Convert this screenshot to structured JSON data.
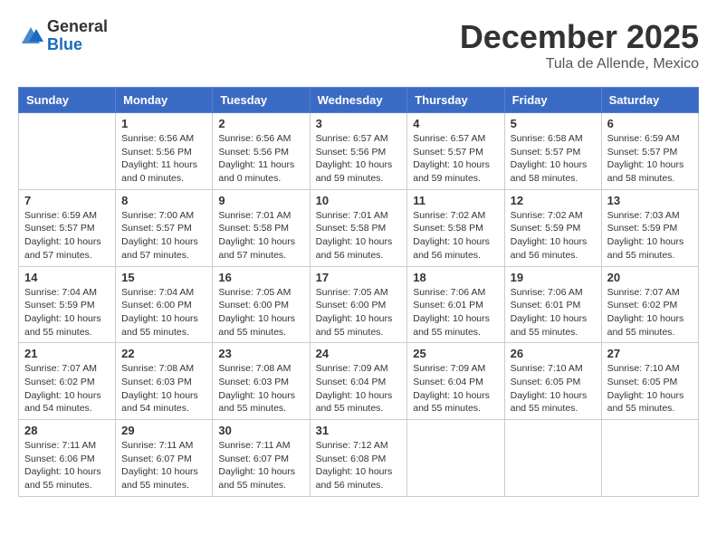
{
  "logo": {
    "general": "General",
    "blue": "Blue"
  },
  "title": "December 2025",
  "location": "Tula de Allende, Mexico",
  "days_of_week": [
    "Sunday",
    "Monday",
    "Tuesday",
    "Wednesday",
    "Thursday",
    "Friday",
    "Saturday"
  ],
  "weeks": [
    [
      {
        "day": "",
        "info": ""
      },
      {
        "day": "1",
        "info": "Sunrise: 6:56 AM\nSunset: 5:56 PM\nDaylight: 11 hours\nand 0 minutes."
      },
      {
        "day": "2",
        "info": "Sunrise: 6:56 AM\nSunset: 5:56 PM\nDaylight: 11 hours\nand 0 minutes."
      },
      {
        "day": "3",
        "info": "Sunrise: 6:57 AM\nSunset: 5:56 PM\nDaylight: 10 hours\nand 59 minutes."
      },
      {
        "day": "4",
        "info": "Sunrise: 6:57 AM\nSunset: 5:57 PM\nDaylight: 10 hours\nand 59 minutes."
      },
      {
        "day": "5",
        "info": "Sunrise: 6:58 AM\nSunset: 5:57 PM\nDaylight: 10 hours\nand 58 minutes."
      },
      {
        "day": "6",
        "info": "Sunrise: 6:59 AM\nSunset: 5:57 PM\nDaylight: 10 hours\nand 58 minutes."
      }
    ],
    [
      {
        "day": "7",
        "info": "Sunrise: 6:59 AM\nSunset: 5:57 PM\nDaylight: 10 hours\nand 57 minutes."
      },
      {
        "day": "8",
        "info": "Sunrise: 7:00 AM\nSunset: 5:57 PM\nDaylight: 10 hours\nand 57 minutes."
      },
      {
        "day": "9",
        "info": "Sunrise: 7:01 AM\nSunset: 5:58 PM\nDaylight: 10 hours\nand 57 minutes."
      },
      {
        "day": "10",
        "info": "Sunrise: 7:01 AM\nSunset: 5:58 PM\nDaylight: 10 hours\nand 56 minutes."
      },
      {
        "day": "11",
        "info": "Sunrise: 7:02 AM\nSunset: 5:58 PM\nDaylight: 10 hours\nand 56 minutes."
      },
      {
        "day": "12",
        "info": "Sunrise: 7:02 AM\nSunset: 5:59 PM\nDaylight: 10 hours\nand 56 minutes."
      },
      {
        "day": "13",
        "info": "Sunrise: 7:03 AM\nSunset: 5:59 PM\nDaylight: 10 hours\nand 55 minutes."
      }
    ],
    [
      {
        "day": "14",
        "info": "Sunrise: 7:04 AM\nSunset: 5:59 PM\nDaylight: 10 hours\nand 55 minutes."
      },
      {
        "day": "15",
        "info": "Sunrise: 7:04 AM\nSunset: 6:00 PM\nDaylight: 10 hours\nand 55 minutes."
      },
      {
        "day": "16",
        "info": "Sunrise: 7:05 AM\nSunset: 6:00 PM\nDaylight: 10 hours\nand 55 minutes."
      },
      {
        "day": "17",
        "info": "Sunrise: 7:05 AM\nSunset: 6:00 PM\nDaylight: 10 hours\nand 55 minutes."
      },
      {
        "day": "18",
        "info": "Sunrise: 7:06 AM\nSunset: 6:01 PM\nDaylight: 10 hours\nand 55 minutes."
      },
      {
        "day": "19",
        "info": "Sunrise: 7:06 AM\nSunset: 6:01 PM\nDaylight: 10 hours\nand 55 minutes."
      },
      {
        "day": "20",
        "info": "Sunrise: 7:07 AM\nSunset: 6:02 PM\nDaylight: 10 hours\nand 55 minutes."
      }
    ],
    [
      {
        "day": "21",
        "info": "Sunrise: 7:07 AM\nSunset: 6:02 PM\nDaylight: 10 hours\nand 54 minutes."
      },
      {
        "day": "22",
        "info": "Sunrise: 7:08 AM\nSunset: 6:03 PM\nDaylight: 10 hours\nand 54 minutes."
      },
      {
        "day": "23",
        "info": "Sunrise: 7:08 AM\nSunset: 6:03 PM\nDaylight: 10 hours\nand 55 minutes."
      },
      {
        "day": "24",
        "info": "Sunrise: 7:09 AM\nSunset: 6:04 PM\nDaylight: 10 hours\nand 55 minutes."
      },
      {
        "day": "25",
        "info": "Sunrise: 7:09 AM\nSunset: 6:04 PM\nDaylight: 10 hours\nand 55 minutes."
      },
      {
        "day": "26",
        "info": "Sunrise: 7:10 AM\nSunset: 6:05 PM\nDaylight: 10 hours\nand 55 minutes."
      },
      {
        "day": "27",
        "info": "Sunrise: 7:10 AM\nSunset: 6:05 PM\nDaylight: 10 hours\nand 55 minutes."
      }
    ],
    [
      {
        "day": "28",
        "info": "Sunrise: 7:11 AM\nSunset: 6:06 PM\nDaylight: 10 hours\nand 55 minutes."
      },
      {
        "day": "29",
        "info": "Sunrise: 7:11 AM\nSunset: 6:07 PM\nDaylight: 10 hours\nand 55 minutes."
      },
      {
        "day": "30",
        "info": "Sunrise: 7:11 AM\nSunset: 6:07 PM\nDaylight: 10 hours\nand 55 minutes."
      },
      {
        "day": "31",
        "info": "Sunrise: 7:12 AM\nSunset: 6:08 PM\nDaylight: 10 hours\nand 56 minutes."
      },
      {
        "day": "",
        "info": ""
      },
      {
        "day": "",
        "info": ""
      },
      {
        "day": "",
        "info": ""
      }
    ]
  ]
}
